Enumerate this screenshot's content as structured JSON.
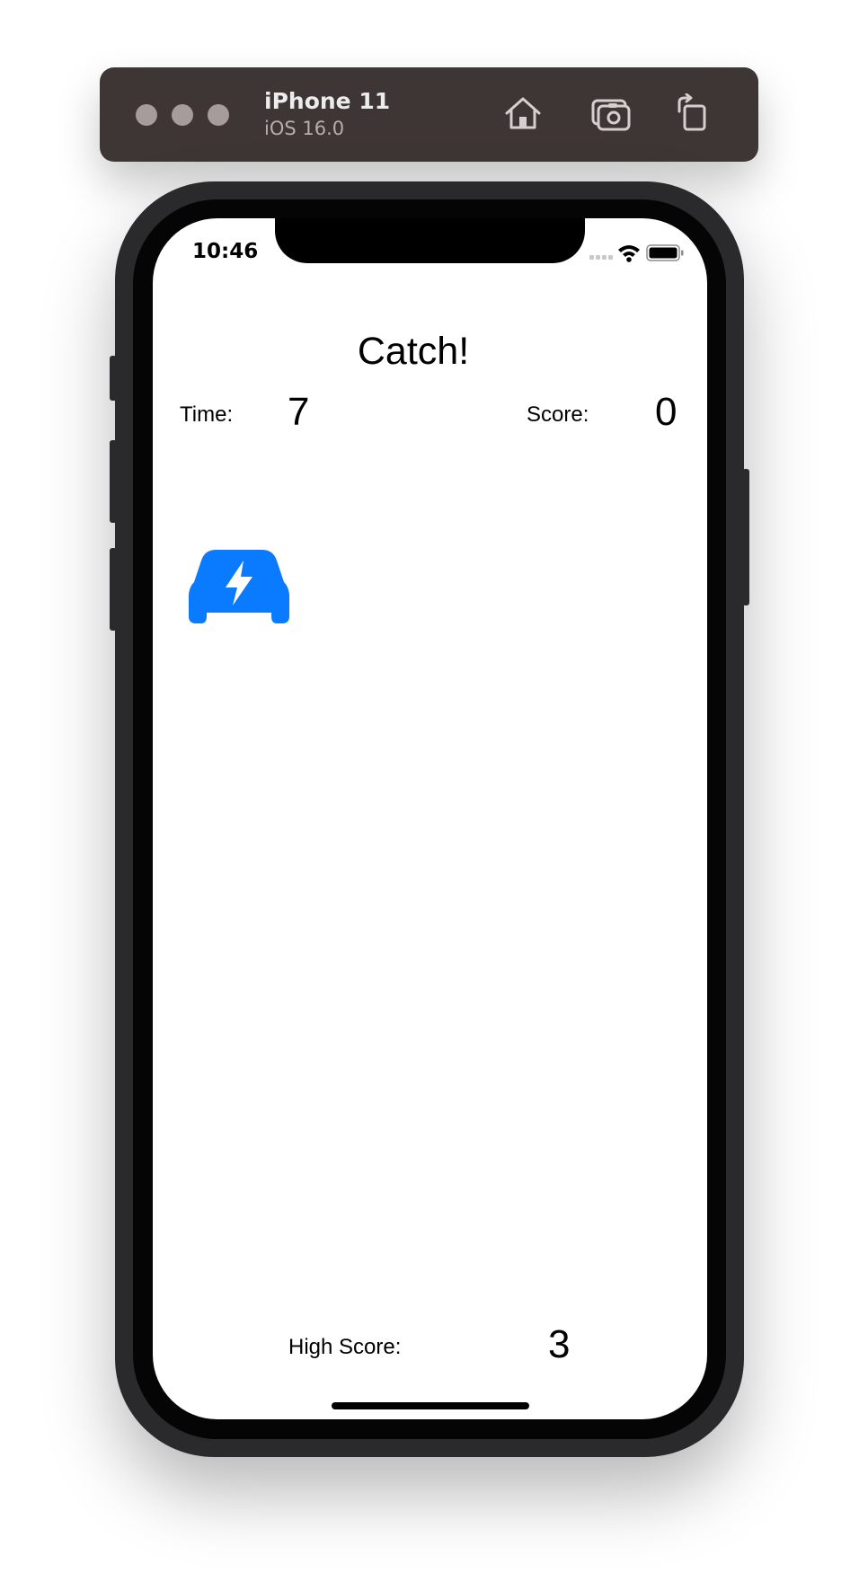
{
  "simulator": {
    "device_name": "iPhone 11",
    "os_version": "iOS 16.0",
    "toolbar_icons": [
      "home-icon",
      "screenshot-icon",
      "rotate-icon"
    ]
  },
  "status_bar": {
    "time": "10:46"
  },
  "app": {
    "title": "Catch!",
    "time_label": "Time:",
    "time_value": "7",
    "score_label": "Score:",
    "score_value": "0",
    "high_score_label": "High Score:",
    "high_score_value": "3",
    "target_icon": "electric-car-icon"
  },
  "colors": {
    "accent": "#0A7AFF",
    "toolbar_bg": "#3E3535",
    "screen_bg": "#FFFFFF"
  }
}
